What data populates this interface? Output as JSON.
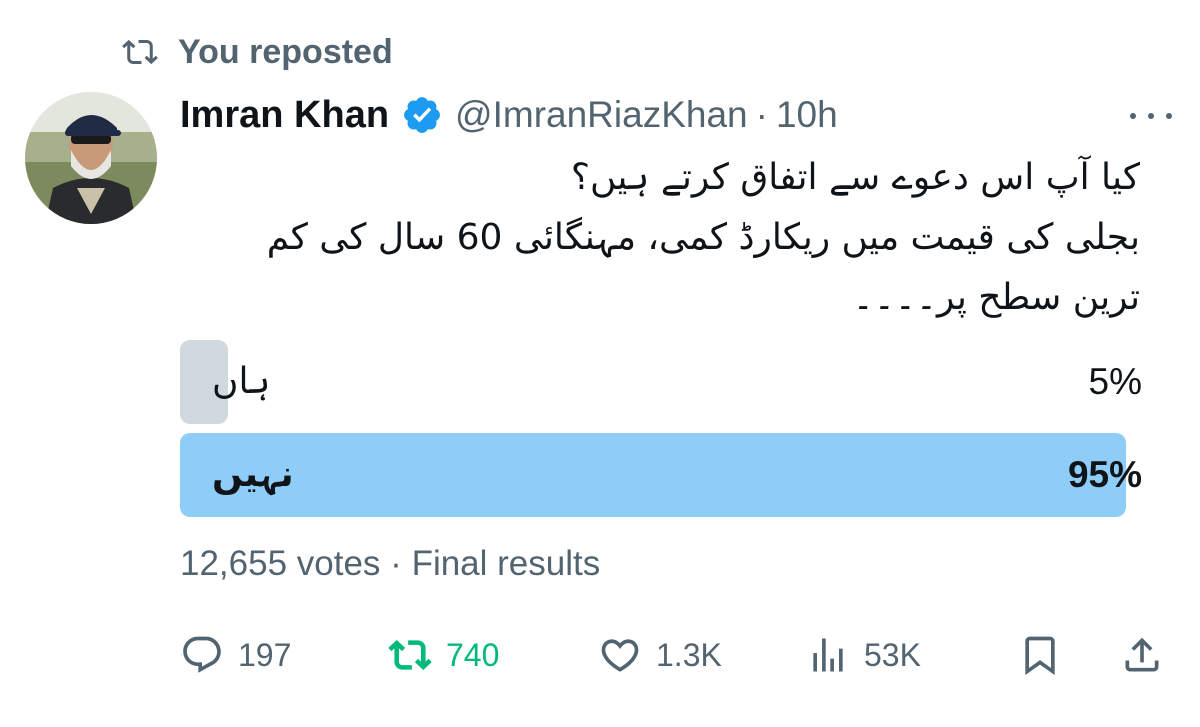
{
  "repost_banner": {
    "label": "You reposted",
    "icon": "repost-icon"
  },
  "author": {
    "name": "Imran Khan",
    "handle": "@ImranRiazKhan",
    "separator": "·",
    "time": "10h",
    "verified": true
  },
  "tweet": {
    "lines": [
      "کیا آپ اس دعوے سے اتفاق کرتے ہیں؟",
      "بجلی کی قیمت میں ریکارڈ کمی، مہنگائی 60 سال کی کم",
      "ترین سطح پر۔۔۔۔"
    ]
  },
  "poll": {
    "options": [
      {
        "label": "ہاں",
        "percent_text": "5%",
        "percent": 5,
        "winner": false
      },
      {
        "label": "نہیں",
        "percent_text": "95%",
        "percent": 95,
        "winner": true
      }
    ],
    "votes": "12,655 votes",
    "separator": "·",
    "status": "Final results"
  },
  "actions": {
    "replies": "197",
    "reposts": "740",
    "likes": "1.3K",
    "views": "53K"
  },
  "colors": {
    "text_primary": "#0f1419",
    "text_secondary": "#536471",
    "verified_blue": "#1d9bf0",
    "repost_green": "#00ba7c",
    "poll_winner": "#8ecdf8",
    "poll_other": "#cfd9de"
  }
}
